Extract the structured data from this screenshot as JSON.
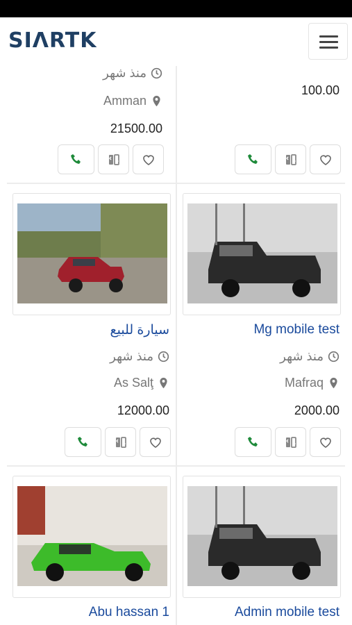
{
  "header": {
    "logo": "SIΛRTK",
    "menu_icon": "hamburger-menu-icon"
  },
  "icons": {
    "time": "clock-icon",
    "location": "map-pin-icon",
    "call": "phone-icon",
    "compare": "compare-icon",
    "favorite": "heart-icon"
  },
  "colors": {
    "brand": "#1f3f63",
    "title": "#1a4a9c",
    "call": "#1e8a3a",
    "status_bar": "#000000"
  },
  "listings": {
    "top_left": {
      "time": "منذ شهر",
      "location": "Amman",
      "price": "21500.00"
    },
    "top_right": {
      "price": "100.00"
    },
    "mid_left": {
      "title": "سيارة للبيع",
      "time": "منذ شهر",
      "location": "As Salţ",
      "price": "12000.00",
      "image": "red suv"
    },
    "mid_right": {
      "title": "Mg mobile test",
      "time": "منذ شهر",
      "location": "Mafraq",
      "price": "2000.00",
      "image": "black pickup"
    },
    "bot_left": {
      "title": "Abu hassan 1",
      "image": "green sports car"
    },
    "bot_right": {
      "title": "Admin mobile test",
      "image": "black pickup"
    }
  }
}
